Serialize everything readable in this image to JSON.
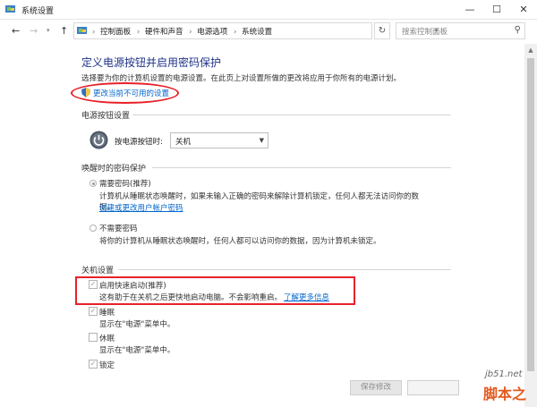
{
  "window": {
    "title": "系统设置",
    "controls": {
      "minimize": "—",
      "maximize": "☐",
      "close": "✕"
    }
  },
  "nav": {
    "breadcrumbs": [
      "控制面板",
      "硬件和声音",
      "电源选项",
      "系统设置"
    ],
    "search_placeholder": "搜索控制面板"
  },
  "page": {
    "heading": "定义电源按钮并启用密码保护",
    "description": "选择要为你的计算机设置的电源设置。在此页上对设置所做的更改将应用于你所有的电源计划。",
    "change_link": "更改当前不可用的设置"
  },
  "power_button": {
    "section_title": "电源按钮设置",
    "label": "按电源按钮时:",
    "selected": "关机"
  },
  "wake_password": {
    "section_title": "唤醒时的密码保护",
    "options": [
      {
        "label": "需要密码(推荐)",
        "checked": true,
        "description": "计算机从睡眠状态唤醒时，如果未输入正确的密码来解除计算机锁定，任何人都无法访问你的数",
        "description2": "据。",
        "link": "创建或更改用户帐户密码"
      },
      {
        "label": "不需要密码",
        "checked": false,
        "description": "将你的计算机从睡眠状态唤醒时，任何人都可以访问你的数据，因为计算机未锁定。"
      }
    ]
  },
  "shutdown": {
    "section_title": "关机设置",
    "items": [
      {
        "label": "启用快速启动(推荐)",
        "checked": true,
        "description": "这有助于在关机之后更快地启动电脑。不会影响重启。",
        "link": "了解更多信息"
      },
      {
        "label": "睡眠",
        "checked": true,
        "description": "显示在\"电源\"菜单中。"
      },
      {
        "label": "休眠",
        "checked": false,
        "description": "显示在\"电源\"菜单中。"
      },
      {
        "label": "锁定",
        "checked": true
      }
    ]
  },
  "footer": {
    "save_label": "保存修改"
  },
  "watermark": {
    "site": "jb51.net",
    "brand": "脚本之家"
  },
  "colors": {
    "heading": "#1e3287",
    "link": "#0066cc",
    "highlight": "#e8212a"
  }
}
